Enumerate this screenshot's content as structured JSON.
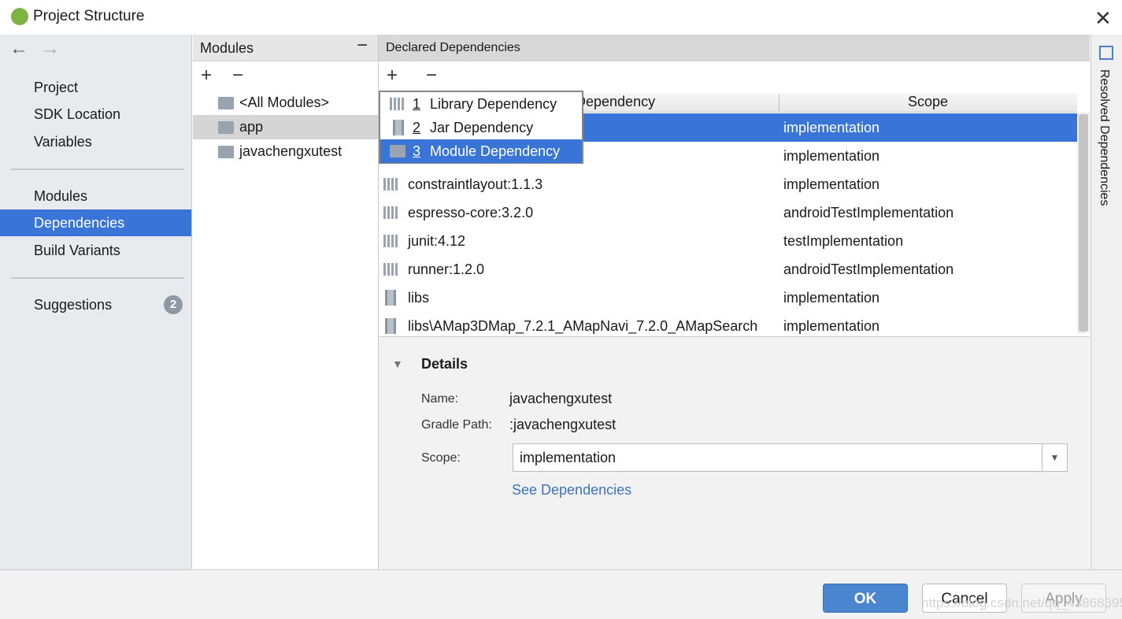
{
  "window": {
    "title": "Project Structure"
  },
  "sidebar": {
    "items": [
      {
        "label": "Project"
      },
      {
        "label": "SDK Location"
      },
      {
        "label": "Variables"
      },
      {
        "label": "Modules"
      },
      {
        "label": "Dependencies"
      },
      {
        "label": "Build Variants"
      },
      {
        "label": "Suggestions",
        "badge": "2"
      }
    ]
  },
  "modules": {
    "header": "Modules",
    "items": [
      {
        "label": "<All Modules>"
      },
      {
        "label": "app"
      },
      {
        "label": "javachengxutest"
      }
    ]
  },
  "dependencies": {
    "header": "Declared Dependencies",
    "columns": [
      "Dependency",
      "Scope"
    ],
    "popup": [
      {
        "num": "1",
        "label": "Library Dependency",
        "icon": "library-icon"
      },
      {
        "num": "2",
        "label": "Jar Dependency",
        "icon": "jar-icon"
      },
      {
        "num": "3",
        "label": "Module Dependency",
        "icon": "module-icon"
      }
    ],
    "rows": [
      {
        "name": "",
        "scope": "implementation",
        "icon": "module"
      },
      {
        "name": "",
        "scope": "implementation",
        "icon": "library"
      },
      {
        "name": "constraintlayout:1.1.3",
        "scope": "implementation",
        "icon": "library"
      },
      {
        "name": "espresso-core:3.2.0",
        "scope": "androidTestImplementation",
        "icon": "library"
      },
      {
        "name": "junit:4.12",
        "scope": "testImplementation",
        "icon": "library"
      },
      {
        "name": "runner:1.2.0",
        "scope": "androidTestImplementation",
        "icon": "library"
      },
      {
        "name": "libs",
        "scope": "implementation",
        "icon": "jar"
      },
      {
        "name": "libs\\AMap3DMap_7.2.1_AMapNavi_7.2.0_AMapSearch",
        "scope": "implementation",
        "icon": "jar"
      }
    ]
  },
  "details": {
    "title": "Details",
    "name_label": "Name:",
    "name_value": "javachengxutest",
    "path_label": "Gradle Path:",
    "path_value": ":javachengxutest",
    "scope_label": "Scope:",
    "scope_value": "implementation",
    "link": "See Dependencies"
  },
  "right_strip": {
    "label": "Resolved Dependencies"
  },
  "buttons": {
    "ok": "OK",
    "cancel": "Cancel",
    "apply": "Apply"
  },
  "watermark": "https://blog.csdn.net/qq_43868395",
  "colors": {
    "accent": "#3875d7",
    "link": "#3d73c4"
  }
}
